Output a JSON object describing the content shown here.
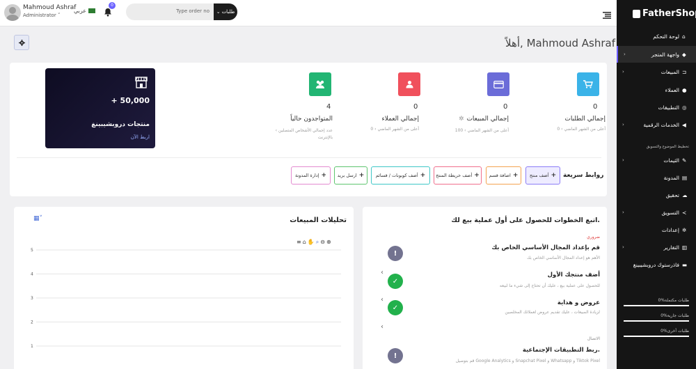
{
  "user": {
    "name": "Mahmoud Ashraf",
    "role": "Administrator ˅"
  },
  "lang": "عربي",
  "notifications": "0",
  "search": {
    "type_label": "طلبات",
    "placeholder": "Type order no"
  },
  "brand": "FatherShops",
  "sidebar": {
    "items": [
      {
        "label": "لوحة التحكم"
      },
      {
        "label": "واجهة المتجر"
      },
      {
        "label": "المبيعات"
      },
      {
        "label": "العملاء"
      },
      {
        "label": "التطبيقات"
      },
      {
        "label": "الخدمات الرقمية"
      },
      {
        "label": "الثيمات"
      },
      {
        "label": "المدونة"
      },
      {
        "label": "تحقيق"
      },
      {
        "label": "التسويق"
      },
      {
        "label": "إعدادات"
      },
      {
        "label": "التقارير"
      },
      {
        "label": "فاذرستوك دروبشيبينغ"
      }
    ],
    "section_label": "تخطيط الموضوع والتسويق",
    "stats": [
      {
        "label": "0%طلبات مكتملة",
        "fill": 0
      },
      {
        "label": "0%طلبات جارية",
        "fill": 0
      },
      {
        "label": "0%طلبات أخرى",
        "fill": 0
      }
    ]
  },
  "greeting": "أهلاً, Mahmoud Ashraf",
  "stats": [
    {
      "value": "0",
      "label": "إجمالي الطلبات",
      "desc": "0 ‹ أعلى من الشهر الماضي",
      "color": "#3ab3e8"
    },
    {
      "value": "0",
      "label": "إجمالي المبيعات",
      "desc": "100 ‹ أعلى من الشهر الماضي",
      "color": "#6b6cd8"
    },
    {
      "value": "0",
      "label": "إجمالي العملاء",
      "desc": "0 ‹ أعلى من الشهر الماضي",
      "color": "#f0505c"
    },
    {
      "value": "4",
      "label": "المتواجدون حالياً",
      "desc": "‹ عدد إجمالي الأشخاص المتصلين",
      "desc2": "بالإنترنت",
      "color": "#22b573"
    }
  ],
  "promo": {
    "amount": "+ 50,000",
    "title": "منتجات دروبشيبينغ",
    "link": "اربط الآن"
  },
  "quick_links": {
    "title": "روابط سريعة",
    "items": [
      {
        "label": "أضف منتج",
        "color": "#8b7cf6"
      },
      {
        "label": "اضافة قسم",
        "color": "#f4a350"
      },
      {
        "label": "أضف خريطة المنتج",
        "color": "#f06e8c"
      },
      {
        "label": "أضف كوبونات / قسائم",
        "color": "#3ec7c7"
      },
      {
        "label": "ارسل بريد",
        "color": "#5ec46e"
      },
      {
        "label": "إدارة المدونة",
        "color": "#e38ad0"
      }
    ]
  },
  "steps": {
    "title": "اتبع الخطوات للحصول على أول عملية بيع لك.",
    "required_label": "ضروري",
    "connect_label": "الاتصال",
    "items": [
      {
        "title": "قم بإعداد المجال الأساسي الخاص بك",
        "desc": "الأهم هو إعداد المجال الأساسي الخاص بك",
        "state": "pending"
      },
      {
        "title": "أضف منتجك الأول",
        "desc": "للحصول على عملية بيع ، عليك أن تحتاج إلى شيء ما لبيعه",
        "state": "done"
      },
      {
        "title": "عروض و هداية",
        "desc": "لزيادة المبيعات ، عليك تقديم عروض لعملائك المخلصين",
        "state": "done"
      },
      {
        "title": "ربط التطبيقات الإجتماعية.",
        "desc": "قم بتوصيل Google Analytics و Snapchat Pixel و Whatsapp و Tiktok Pixel",
        "state": "pending"
      }
    ]
  },
  "analytics": {
    "title": "تحليلات المبيعات"
  },
  "chart_data": {
    "type": "line",
    "title": "",
    "yticks": [
      "5",
      "4",
      "3",
      "2",
      "1"
    ],
    "ylim": [
      0,
      5
    ],
    "series": []
  }
}
